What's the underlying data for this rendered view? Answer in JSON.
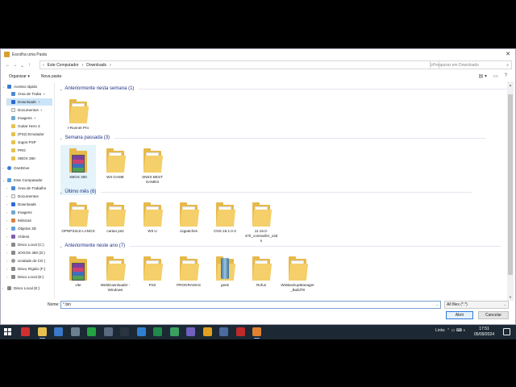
{
  "window": {
    "title": "Escolha uma Pasta",
    "close_glyph": "✕"
  },
  "nav": {
    "back": "←",
    "forward": "→",
    "recent": "⌄",
    "up": "↑"
  },
  "address": {
    "segments": [
      "›",
      "Este Computador",
      "›",
      "Downloads",
      "›"
    ],
    "dropdown": "⌄",
    "refresh": "↻"
  },
  "search": {
    "placeholder": "Pesquisar em Downloads",
    "icon": "⌕"
  },
  "toolbar": {
    "organize_label": "Organizar ▾",
    "new_folder_label": "Nova pasta",
    "view_icons": [
      "▤ ▾",
      "▭",
      "?"
    ]
  },
  "sidebar": {
    "items": [
      {
        "label": "Acesso rápido",
        "icon": "star",
        "chev": "⌄",
        "pin": "",
        "selected": false
      },
      {
        "label": "Área de Traba",
        "icon": "desk",
        "chev": "",
        "pin": "✦",
        "selected": false
      },
      {
        "label": "Downloads",
        "icon": "down",
        "chev": "",
        "pin": "✦",
        "selected": true
      },
      {
        "label": "Documentos",
        "icon": "doc",
        "chev": "",
        "pin": "✦",
        "selected": false
      },
      {
        "label": "Imagens",
        "icon": "img",
        "chev": "",
        "pin": "✦",
        "selected": false
      },
      {
        "label": "Guitar Hero 3",
        "icon": "folder",
        "chev": "",
        "pin": "",
        "selected": false
      },
      {
        "label": "(PS2) Emulador",
        "icon": "folder",
        "chev": "",
        "pin": "",
        "selected": false
      },
      {
        "label": "Jogos PSP",
        "icon": "folder",
        "chev": "",
        "pin": "",
        "selected": false
      },
      {
        "label": "PRG",
        "icon": "folder",
        "chev": "",
        "pin": "",
        "selected": false
      },
      {
        "label": "XBOX 360",
        "icon": "folder",
        "chev": "",
        "pin": "",
        "selected": false
      },
      {
        "label": "OneDrive",
        "icon": "cloud",
        "chev": "›",
        "pin": "",
        "selected": false
      },
      {
        "label": "Este Computador",
        "icon": "pc",
        "chev": "⌄",
        "pin": "",
        "selected": false
      },
      {
        "label": "Área de Trabalho",
        "icon": "desk",
        "chev": "›",
        "pin": "",
        "selected": false
      },
      {
        "label": "Documentos",
        "icon": "doc",
        "chev": "›",
        "pin": "",
        "selected": false
      },
      {
        "label": "Downloads",
        "icon": "down",
        "chev": "›",
        "pin": "",
        "selected": false
      },
      {
        "label": "Imagens",
        "icon": "img",
        "chev": "›",
        "pin": "",
        "selected": false
      },
      {
        "label": "Músicas",
        "icon": "music",
        "chev": "›",
        "pin": "",
        "selected": false
      },
      {
        "label": "Objetos 3D",
        "icon": "obj",
        "chev": "›",
        "pin": "",
        "selected": false
      },
      {
        "label": "Vídeos",
        "icon": "vid",
        "chev": "›",
        "pin": "",
        "selected": false
      },
      {
        "label": "Disco Local (C:)",
        "icon": "drive",
        "chev": "›",
        "pin": "",
        "selected": false
      },
      {
        "label": "JOGOS 360 (D:)",
        "icon": "drive",
        "chev": "›",
        "pin": "",
        "selected": false
      },
      {
        "label": "Unidade de CD (",
        "icon": "cd",
        "chev": "›",
        "pin": "",
        "selected": false
      },
      {
        "label": "Disco Rígido (F:)",
        "icon": "drive",
        "chev": "›",
        "pin": "",
        "selected": false
      },
      {
        "label": "Disco Local (E:)",
        "icon": "drive",
        "chev": "›",
        "pin": "",
        "selected": false
      },
      {
        "label": "Disco Local (E:)",
        "icon": "drive",
        "chev": "›",
        "pin": "",
        "selected": false
      }
    ]
  },
  "groups": [
    {
      "header": "Anteriormente nesta semana (1)",
      "chev": "⌄",
      "items": [
        {
          "label": "I-Runner.Pro",
          "type": "folder",
          "selected": false
        }
      ]
    },
    {
      "header": "Semana passada (3)",
      "chev": "⌄",
      "items": [
        {
          "label": "XBOX 360",
          "type": "rar",
          "selected": true
        },
        {
          "label": "WII GAME",
          "type": "folder",
          "selected": false
        },
        {
          "label": "SNES BEST GAMES",
          "type": "folder",
          "selected": false
        }
      ]
    },
    {
      "header": "Último mês (6)",
      "chev": "⌄",
      "items": [
        {
          "label": "OPNPS2LD LANGS",
          "type": "folder",
          "selected": false
        },
        {
          "label": "cartao ps2",
          "type": "folder",
          "selected": false
        },
        {
          "label": "WII U",
          "type": "folder",
          "selected": false
        },
        {
          "label": "ciqpatches",
          "type": "folder",
          "selected": false
        },
        {
          "label": "CNX.18.1.0-2",
          "type": "folder",
          "selected": false
        },
        {
          "label": "11.15.0-470_contrasfer_x3ds",
          "type": "folder",
          "selected": false
        }
      ]
    },
    {
      "header": "Anteriormente neste ano (7)",
      "chev": "⌄",
      "items": [
        {
          "label": "vite",
          "type": "rar",
          "selected": false
        },
        {
          "label": "WebDownloader -Windows",
          "type": "folder",
          "selected": false
        },
        {
          "label": "PS2",
          "type": "folder",
          "selected": false
        },
        {
          "label": "PROGRAMAS",
          "type": "folder",
          "selected": false
        },
        {
          "label": "geek",
          "type": "app",
          "selected": false
        },
        {
          "label": "Rufus",
          "type": "folder",
          "selected": false
        },
        {
          "label": "WinBackupManager_Build78",
          "type": "folder",
          "selected": false
        }
      ]
    }
  ],
  "footer": {
    "name_label": "Nome:",
    "name_value": "*.bin",
    "filter_value": "All files (*.*)",
    "dropdown_glyph": "⌄",
    "open_label": "Abrir",
    "cancel_label": "Cancelar"
  },
  "scrollbar": {
    "up": "▲",
    "down": "▼"
  },
  "taskbar": {
    "tray_text": "Links",
    "tray_icons": "⌃  ▭  ⌨  ◖",
    "time": "17:51",
    "date": "05/09/2024",
    "apps": [
      {
        "name": "vivaldi-icon",
        "color": "#d03030",
        "active": false
      },
      {
        "name": "file-explorer-icon",
        "color": "#e8c050",
        "active": true
      },
      {
        "name": "app-blue-icon",
        "color": "#3a78c8",
        "active": false
      },
      {
        "name": "app-gear-icon",
        "color": "#6a7f90",
        "active": false
      },
      {
        "name": "whatsapp-icon",
        "color": "#25a244",
        "active": false
      },
      {
        "name": "app-grid-icon",
        "color": "#5a6a80",
        "active": false
      },
      {
        "name": "app-jr-icon",
        "color": "#2a3440",
        "active": false
      },
      {
        "name": "app-store-icon",
        "color": "#2f7fd0",
        "active": false
      },
      {
        "name": "excel-icon",
        "color": "#1f8a4c",
        "active": false
      },
      {
        "name": "app-green-icon",
        "color": "#3aa060",
        "active": false
      },
      {
        "name": "app-purple-icon",
        "color": "#7060c0",
        "active": false
      },
      {
        "name": "chrome-icon",
        "color": "#e0a020",
        "active": false
      },
      {
        "name": "app-ps-icon",
        "color": "#4a6aa0",
        "active": false
      },
      {
        "name": "app-red-icon",
        "color": "#c02a2a",
        "active": false
      },
      {
        "name": "app-orange-icon",
        "color": "#e08030",
        "active": true
      }
    ]
  },
  "colors": {
    "accent": "#2f78d7",
    "group_header": "#1e3287",
    "selection": "#cce4f7",
    "taskbar": "#1c2833"
  }
}
